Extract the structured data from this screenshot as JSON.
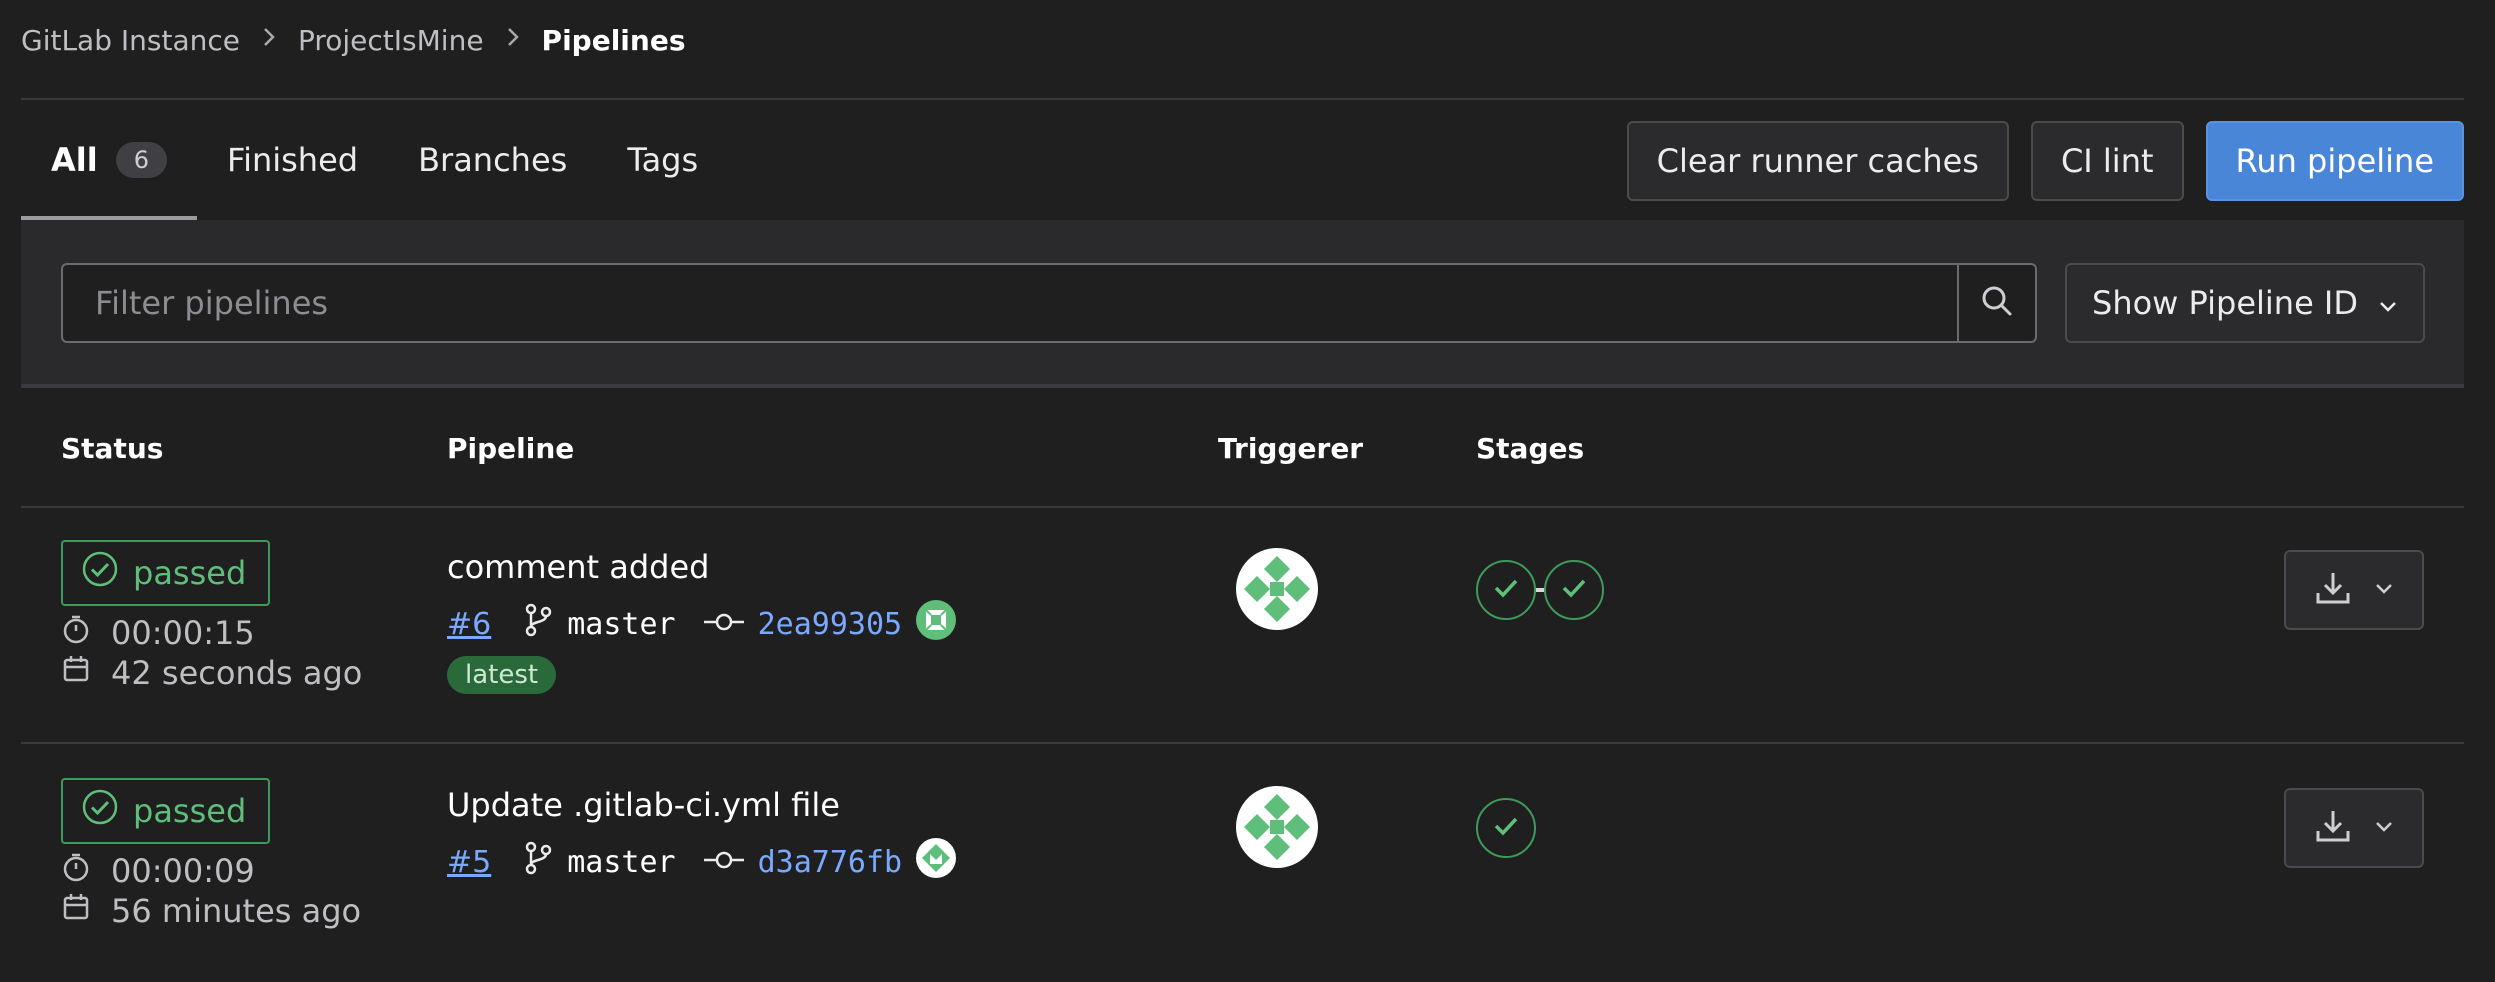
{
  "breadcrumb": {
    "items": [
      "GitLab Instance",
      "ProjectIsMine"
    ],
    "current": "Pipelines"
  },
  "tabs": [
    {
      "label": "All",
      "count": "6",
      "active": true
    },
    {
      "label": "Finished"
    },
    {
      "label": "Branches"
    },
    {
      "label": "Tags"
    }
  ],
  "actions": {
    "clear_caches": "Clear runner caches",
    "ci_lint": "CI lint",
    "run_pipeline": "Run pipeline"
  },
  "filter": {
    "placeholder": "Filter pipelines",
    "show_id": "Show Pipeline ID"
  },
  "table": {
    "headers": {
      "status": "Status",
      "pipeline": "Pipeline",
      "triggerer": "Triggerer",
      "stages": "Stages"
    }
  },
  "rows": [
    {
      "status": "passed",
      "duration": "00:00:15",
      "finished": "42 seconds ago",
      "title": "comment added",
      "id": "#6",
      "branch": "master",
      "sha": "2ea99305",
      "badge": "latest",
      "stage_count": 2
    },
    {
      "status": "passed",
      "duration": "00:00:09",
      "finished": "56 minutes ago",
      "title": "Update .gitlab-ci.yml file",
      "id": "#5",
      "branch": "master",
      "sha": "d3a776fb",
      "stage_count": 1
    }
  ],
  "colors": {
    "background": "#1f1f1f",
    "success": "#3e9a5a",
    "link": "#7aa9ff",
    "primary": "#4a86d8"
  }
}
